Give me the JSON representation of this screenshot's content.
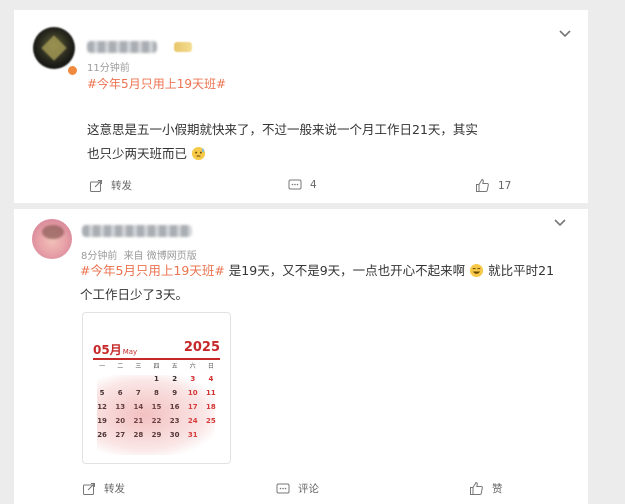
{
  "post1": {
    "time": "11分钟前",
    "hashtag": "#今年5月只用上19天班#",
    "body": "这意思是五一小假期就快来了，不过一般来说一个月工作日21天，其实也只少两天班而已",
    "actions": {
      "repost": "转发",
      "comments": "4",
      "likes": "17"
    }
  },
  "post2": {
    "time": "8分钟前",
    "source": "来自 微博网页版",
    "hashtag": "#今年5月只用上19天班#",
    "body_part1": " 是19天，又不是9天，一点也开心不起来啊",
    "body_part2": " 就比平时21个工作日少了3天。",
    "calendar": {
      "month": "05月",
      "month_en": "May",
      "year": "2025",
      "weekdays": [
        "一",
        "二",
        "三",
        "四",
        "五",
        "六",
        "日"
      ],
      "rows": [
        [
          "",
          "",
          "",
          "1",
          "2",
          "3",
          "4"
        ],
        [
          "5",
          "6",
          "7",
          "8",
          "9",
          "10",
          "11"
        ],
        [
          "12",
          "13",
          "14",
          "15",
          "16",
          "17",
          "18"
        ],
        [
          "19",
          "20",
          "21",
          "22",
          "23",
          "24",
          "25"
        ],
        [
          "26",
          "27",
          "28",
          "29",
          "30",
          "31",
          ""
        ]
      ]
    },
    "actions": {
      "repost": "转发",
      "comment": "评论",
      "like": "赞"
    }
  },
  "colors": {
    "hashtag": "#eb7350",
    "calendar_red": "#c62828",
    "background": "#ececec"
  },
  "icons": [
    "chevron-down-icon",
    "repost-icon",
    "comment-icon",
    "like-icon",
    "emoji-icon"
  ]
}
